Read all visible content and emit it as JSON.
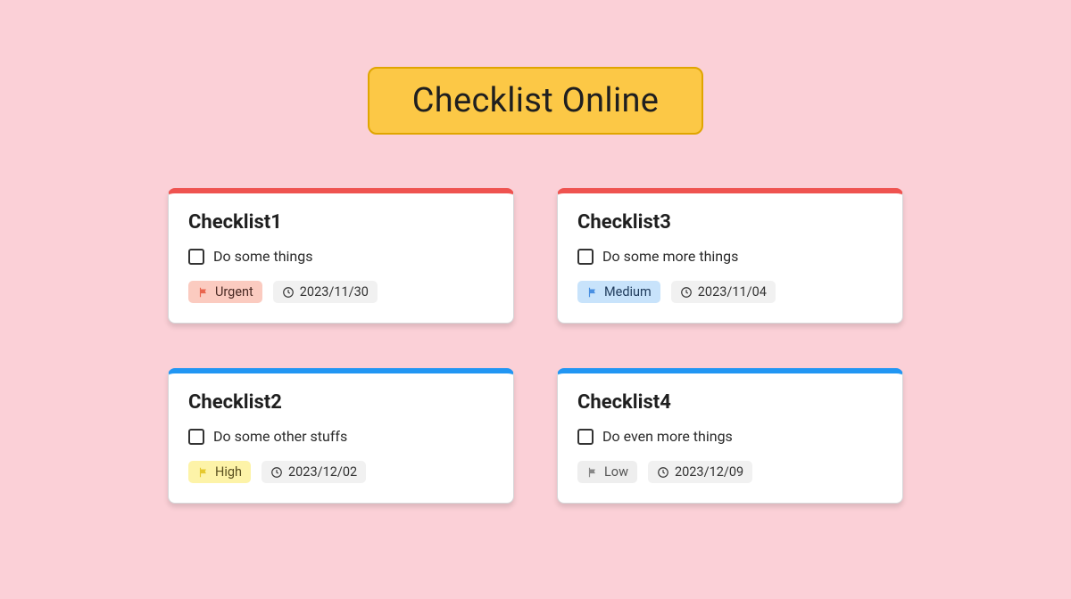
{
  "header": {
    "title": "Checklist Online"
  },
  "cards": [
    {
      "title": "Checklist1",
      "task": "Do some things",
      "priority_label": "Urgent",
      "priority_class": "urgent",
      "flag_color": "#e9664f",
      "date": "2023/11/30",
      "accent": "red"
    },
    {
      "title": "Checklist3",
      "task": "Do some more things",
      "priority_label": "Medium",
      "priority_class": "medium",
      "flag_color": "#4a90e2",
      "date": "2023/11/04",
      "accent": "red"
    },
    {
      "title": "Checklist2",
      "task": "Do some other stuffs",
      "priority_label": "High",
      "priority_class": "high",
      "flag_color": "#e6c92f",
      "date": "2023/12/02",
      "accent": "blue"
    },
    {
      "title": "Checklist4",
      "task": "Do even more things",
      "priority_label": "Low",
      "priority_class": "low",
      "flag_color": "#888888",
      "date": "2023/12/09",
      "accent": "blue"
    }
  ]
}
